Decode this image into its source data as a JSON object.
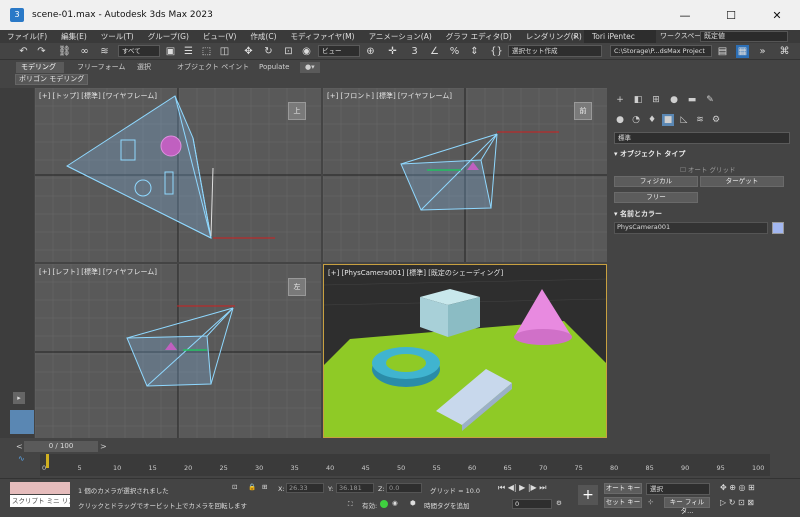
{
  "window": {
    "title": "scene-01.max - Autodesk 3ds Max 2023",
    "minimize": "—",
    "maximize": "☐",
    "close": "✕"
  },
  "menu": {
    "items": [
      "ファイル(F)",
      "編集(E)",
      "ツール(T)",
      "グループ(G)",
      "ビュー(V)",
      "作成(C)",
      "モディファイヤ(M)",
      "アニメーション(A)",
      "グラフ エディタ(D)",
      "レンダリング(R)"
    ],
    "more": "»",
    "user": "Tori iPentec",
    "workspace_label": "ワークスペース:",
    "workspace_value": "既定値"
  },
  "toolbar": {
    "filter": "すべて",
    "coord": "ビュー",
    "selection_set": "選択セット作成",
    "project_path": "C:\\Storage\\P...dsMax Project"
  },
  "ribbon": {
    "tabs": [
      "モデリング",
      "フリーフォーム",
      "選択",
      "オブジェクト ペイント",
      "Populate"
    ],
    "active": "モデリング",
    "sub": "ポリゴン モデリング"
  },
  "viewports": {
    "top": {
      "label": "[+] [トップ] [標準] [ワイヤフレーム]",
      "cube": "上"
    },
    "front": {
      "label": "[+] [フロント] [標準] [ワイヤフレーム]",
      "cube": "前"
    },
    "left": {
      "label": "[+] [レフト] [標準] [ワイヤフレーム]",
      "cube": "左"
    },
    "camera": {
      "label": "[+] [PhysCamera001] [標準] [既定のシェーディング]"
    }
  },
  "command_panel": {
    "category": "標準",
    "object_type_title": "オブジェクト タイプ",
    "autogrid": "オート グリッド",
    "buttons": [
      "フィジカル",
      "ターゲット",
      "フリー"
    ],
    "name_color_title": "名前とカラー",
    "object_name": "PhysCamera001",
    "object_color": "#a3b7f0"
  },
  "timeline": {
    "counter": "0 / 100",
    "ticks": [
      "0",
      "5",
      "10",
      "15",
      "20",
      "25",
      "30",
      "35",
      "40",
      "45",
      "50",
      "55",
      "60",
      "65",
      "70",
      "75",
      "80",
      "85",
      "90",
      "95",
      "100"
    ]
  },
  "status": {
    "maxscript": "スクリプト ミニ リス",
    "line1": "1 個のカメラが選択されました",
    "line2": "クリックとドラッグでオービット上でカメラを回転します",
    "x_label": "X:",
    "x_value": "26.33",
    "y_label": "Y:",
    "y_value": "36.181",
    "z_label": "Z:",
    "z_value": "0.0",
    "grid": "グリッド = 10.0",
    "enabled": "有効:",
    "add_time_tag": "時間タグを追加",
    "auto_key": "オート キー",
    "set_key": "セット キー",
    "selection": "選択",
    "key_filter": "キー フィルタ...",
    "frame": "0"
  }
}
